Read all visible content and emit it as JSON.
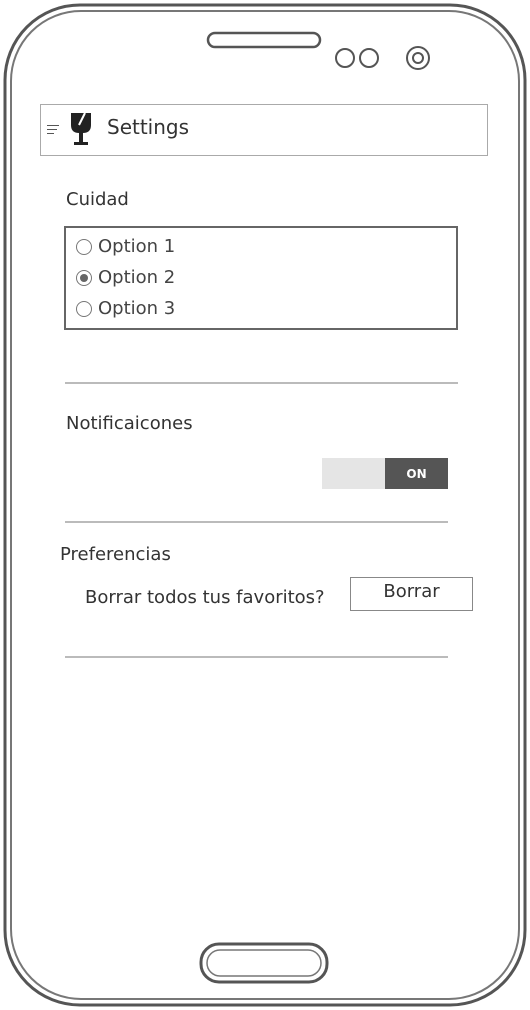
{
  "appbar": {
    "title": "Settings",
    "menu_icon": "hamburger-menu-icon",
    "logo_icon": "fragile-glass-icon"
  },
  "care": {
    "label": "Cuidad",
    "options": [
      {
        "label": "Option 1",
        "selected": false
      },
      {
        "label": "Option 2",
        "selected": true
      },
      {
        "label": "Option 3",
        "selected": false
      }
    ]
  },
  "notifications": {
    "label": "Notificaicones",
    "toggle_label": "ON",
    "enabled": true
  },
  "preferences": {
    "label": "Preferencias",
    "question": "Borrar todos tus favoritos?",
    "button_label": "Borrar"
  },
  "colors": {
    "toggle_on": "#555555",
    "toggle_off": "#e5e5e5",
    "frame": "#555555"
  }
}
